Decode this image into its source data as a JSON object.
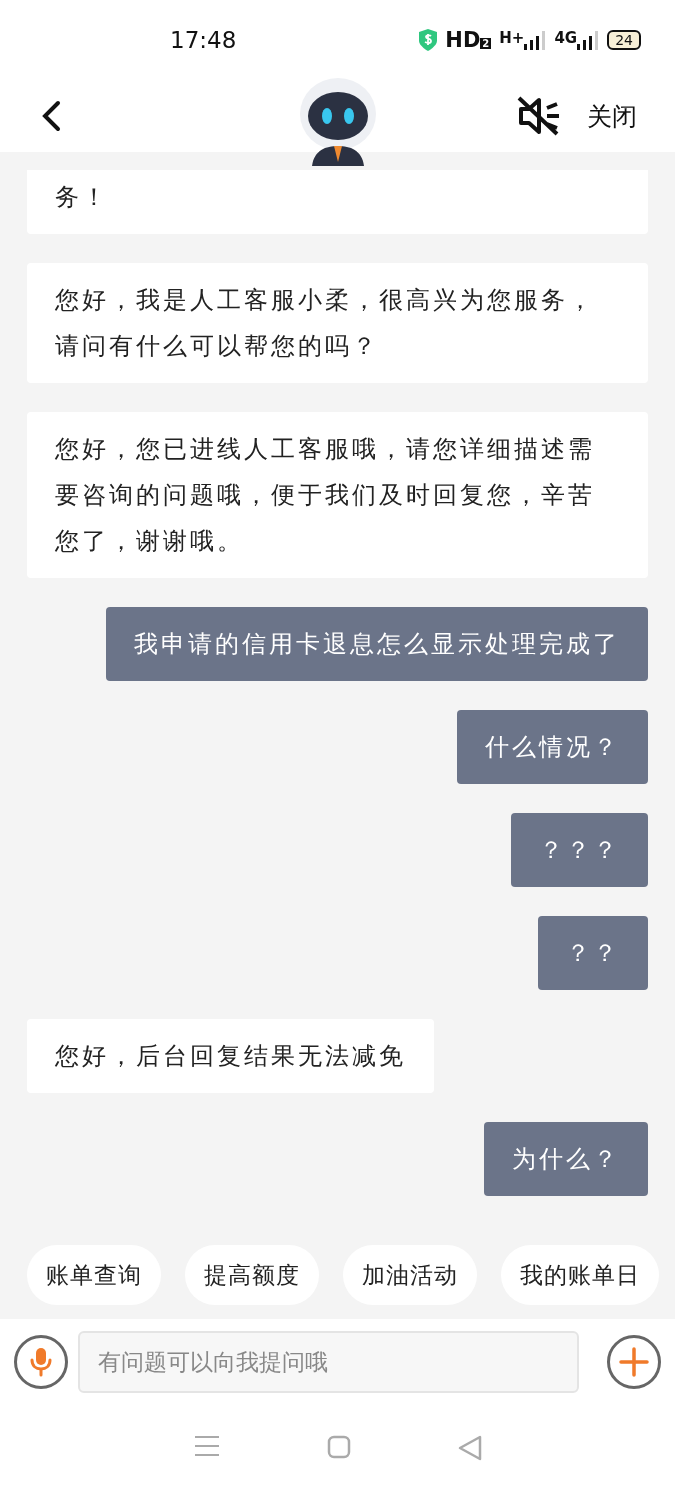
{
  "status_bar": {
    "time": "17:48",
    "network": [
      {
        "kind": "hd",
        "label": "HD",
        "sub": "2"
      },
      {
        "kind": "signal",
        "label": "H+"
      },
      {
        "kind": "signal",
        "label": "4G"
      }
    ],
    "battery": "24"
  },
  "header": {
    "close": "关闭"
  },
  "messages": [
    {
      "kind": "agent",
      "text": "务！",
      "cut_top": true
    },
    {
      "kind": "agent",
      "text": "您好，我是人工客服小柔，很高兴为您服务，请问有什么可以帮您的吗？",
      "cut_top": false
    },
    {
      "kind": "agent",
      "text": "您好，您已进线人工客服哦，请您详细描述需要咨询的问题哦，便于我们及时回复您，辛苦您了，谢谢哦。",
      "cut_top": false
    },
    {
      "kind": "user",
      "text": "我申请的信用卡退息怎么显示处理完成了",
      "cut_top": false
    },
    {
      "kind": "user",
      "text": "什么情况？",
      "cut_top": false
    },
    {
      "kind": "user",
      "text": "？？？",
      "cut_top": false
    },
    {
      "kind": "user",
      "text": "？？",
      "cut_top": false
    },
    {
      "kind": "agent",
      "text": "您好，后台回复结果无法减免",
      "cut_top": false
    },
    {
      "kind": "user",
      "text": "为什么？",
      "cut_top": false
    }
  ],
  "quick_replies": [
    "账单查询",
    "提高额度",
    "加油活动",
    "我的账单日"
  ],
  "input": {
    "placeholder": "有问题可以向我提问哦"
  }
}
